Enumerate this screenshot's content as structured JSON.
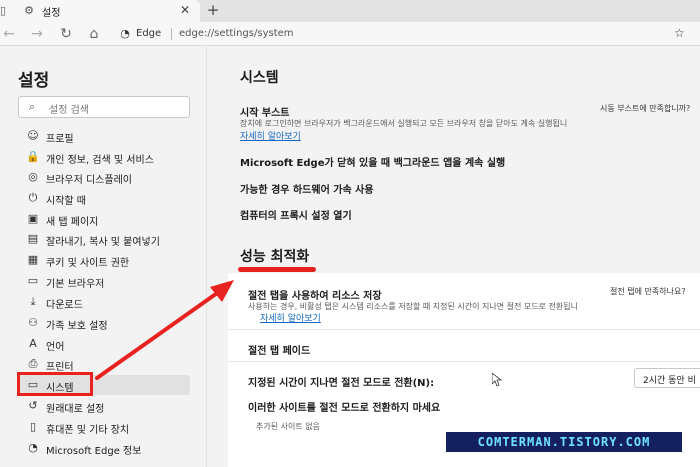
{
  "tab": {
    "title": "설정"
  },
  "address": {
    "site_label": "Edge",
    "url": "edge://settings/system"
  },
  "sidebar": {
    "title": "설정",
    "search_placeholder": "설정 검색",
    "items": [
      {
        "label": "프로필",
        "icon": "profile-icon"
      },
      {
        "label": "개인 정보, 검색 및 서비스",
        "icon": "lock-icon"
      },
      {
        "label": "브라우저 디스플레이",
        "icon": "appearance-icon"
      },
      {
        "label": "시작할 때",
        "icon": "power-icon"
      },
      {
        "label": "새 탭 페이지",
        "icon": "new-tab-icon"
      },
      {
        "label": "잘라내기, 복사 및 붙여넣기",
        "icon": "clipboard-icon"
      },
      {
        "label": "쿠키 및 사이트 권한",
        "icon": "site-permissions-icon"
      },
      {
        "label": "기본 브라우저",
        "icon": "browser-icon"
      },
      {
        "label": "다운로드",
        "icon": "download-icon"
      },
      {
        "label": "가족 보호 설정",
        "icon": "family-icon"
      },
      {
        "label": "언어",
        "icon": "language-icon"
      },
      {
        "label": "프린터",
        "icon": "printer-icon"
      },
      {
        "label": "시스템",
        "icon": "system-icon"
      },
      {
        "label": "원래대로 설정",
        "icon": "reset-icon"
      },
      {
        "label": "휴대폰 및 기타 장치",
        "icon": "phone-icon"
      },
      {
        "label": "Microsoft Edge 정보",
        "icon": "edge-icon"
      }
    ]
  },
  "system": {
    "title": "시스템",
    "startup_boost": {
      "title": "시작 부스트",
      "desc": "장치에 로그인하면 브라우저가 백그라운드에서 실행되고 모든 브라우저 창을 닫아도 계속 실행됩니",
      "link": "자세히 알아보기",
      "feedback": "시동 부스트에 만족합니까?"
    },
    "background_apps": "Microsoft Edge가 닫혀 있을 때 백그라운드 앱을 계속 실행",
    "hardware_accel": "가능한 경우 하드웨어 가속 사용",
    "proxy": "컴퓨터의 프록시 설정 열기"
  },
  "performance": {
    "title": "성능 최적화",
    "sleeping_tabs": {
      "title": "절전 탭을 사용하여 리소스 저장",
      "desc": "사용하는 경우, 비활성 탭은 시스템 리소스를 저장할 때 지정된 시간이 지나면 절전 모드로 전환됩니",
      "link": "자세히 알아보기",
      "feedback": "절전 탭에 만족하나요?"
    },
    "fade": "절전 탭 페이드",
    "timeout": {
      "label": "지정된 시간이 지나면 절전 모드로 전환(N):",
      "value": "2시간 동안 비"
    },
    "never_sleep": {
      "label": "이러한 사이트를 절전 모드로 전환하지 마세요",
      "empty": "추가된 사이트 없음"
    }
  },
  "watermark": "COMTERMAN.TISTORY.COM",
  "colors": {
    "highlight": "#e8221e",
    "link": "#1667c2",
    "watermark_bg": "#15215f",
    "watermark_text": "#6ee3ff"
  }
}
